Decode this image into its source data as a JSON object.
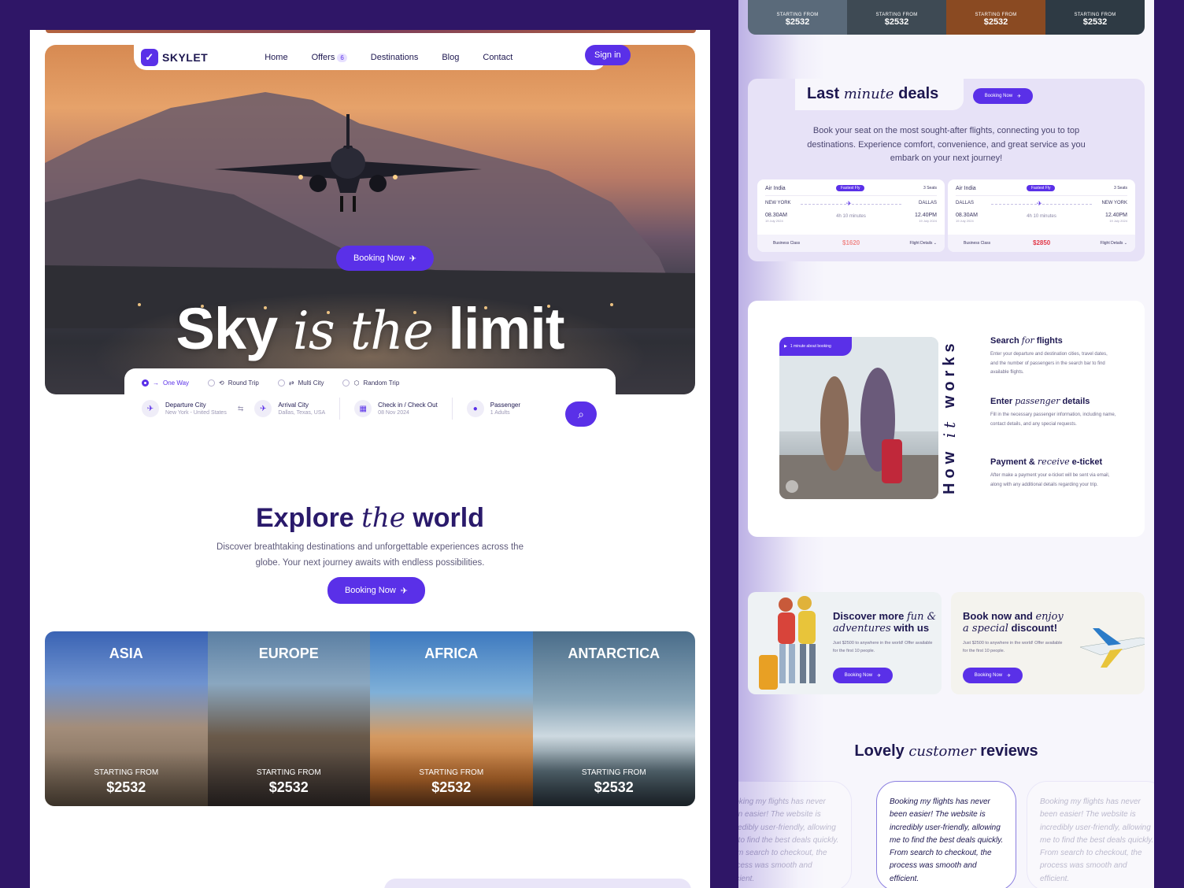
{
  "brand": {
    "name": "SKYLET",
    "accent": "#5a30e8",
    "background": "#2f1667"
  },
  "nav": {
    "links": [
      "Home",
      "Offers",
      "Destinations",
      "Blog",
      "Contact"
    ],
    "offers_badge": "6",
    "sign_in": "Sign in"
  },
  "hero": {
    "booking_label": "Booking Now",
    "title_a": "Sky",
    "title_b": "is the",
    "title_c": "limit"
  },
  "search": {
    "trip_types": [
      "One Way",
      "Round Trip",
      "Multi City",
      "Random Trip"
    ],
    "selected_trip": "One Way",
    "departure": {
      "label": "Departure City",
      "value": "New York - United States"
    },
    "arrival": {
      "label": "Arrival City",
      "value": "Dallas, Texas, USA"
    },
    "dates": {
      "label": "Check in / Check Out",
      "value": "08 Nov 2024"
    },
    "passenger": {
      "label": "Passenger",
      "value": "1 Adults"
    }
  },
  "explore": {
    "title_a": "Explore",
    "title_b": "the",
    "title_c": "world",
    "description": "Discover breathtaking destinations and unforgettable experiences across the globe. Your next journey awaits with endless possibilities.",
    "booking_label": "Booking Now",
    "destinations": [
      {
        "name": "ASIA",
        "from": "STARTING FROM",
        "price": "$2532"
      },
      {
        "name": "EUROPE",
        "from": "STARTING FROM",
        "price": "$2532"
      },
      {
        "name": "AFRICA",
        "from": "STARTING FROM",
        "price": "$2532"
      },
      {
        "name": "ANTARCTICA",
        "from": "STARTING FROM",
        "price": "$2532"
      }
    ]
  },
  "right": {
    "top_cards": [
      {
        "from": "STARTING FROM",
        "price": "$2532"
      },
      {
        "from": "STARTING FROM",
        "price": "$2532"
      },
      {
        "from": "STARTING FROM",
        "price": "$2532"
      },
      {
        "from": "STARTING FROM",
        "price": "$2532"
      }
    ],
    "last_minute": {
      "title_a": "Last",
      "title_b": "minute",
      "title_c": "deals",
      "booking_label": "Booking Now",
      "description": "Book your seat on the most sought-after flights, connecting you to top destinations. Experience comfort, convenience, and great service as you embark on your next journey!",
      "tickets": [
        {
          "airline": "Air India",
          "tag": "Fastest Fly",
          "seats": "3 Seats",
          "from_city": "NEW YORK",
          "to_city": "DALLAS",
          "dep_time": "08.30AM",
          "arr_time": "12.40PM",
          "dep_date": "19 July 2024",
          "arr_date": "19 July 2024",
          "duration": "4h 10 minutes",
          "class": "Business Class",
          "price": "$1620",
          "details": "Flight Details"
        },
        {
          "airline": "Air India",
          "tag": "Fastest Fly",
          "seats": "3 Seats",
          "from_city": "DALLAS",
          "to_city": "NEW YORK",
          "dep_time": "08.30AM",
          "arr_time": "12.40PM",
          "dep_date": "19 July 2024",
          "arr_date": "19 July 2024",
          "duration": "4h 10 minutes",
          "class": "Business Class",
          "price": "$2850",
          "details": "Flight Details"
        }
      ]
    },
    "how": {
      "badge": "1 minute about booking",
      "title_a": "How",
      "title_b": "it",
      "title_c": "works",
      "steps": [
        {
          "title_a": "Search",
          "title_b": "for",
          "title_c": "flights",
          "text": "Enter your departure and destination cities, travel dates, and the number of passengers in the search bar to find available flights."
        },
        {
          "title_a": "Enter",
          "title_b": "passenger",
          "title_c": "details",
          "text": "Fill in the necessary passenger information, including name, contact details, and any special requests."
        },
        {
          "title_a": "Payment &",
          "title_b": "receive",
          "title_c": "e-ticket",
          "text": "After make a payment your e-ticket will be sent via email, along with any additional details regarding your trip."
        }
      ]
    },
    "promos": [
      {
        "title_a": "Discover more",
        "title_b": "fun &",
        "title_c": "adventures",
        "title_d": "with us",
        "text": "Just $2500 to anywhere in the world! Offer available for the first 10 people.",
        "button": "Booking Now"
      },
      {
        "title_a": "Book now and",
        "title_b": "enjoy",
        "title_c": "a special",
        "title_d": "discount!",
        "text": "Just $2500 to anywhere in the world! Offer available for the first 10 people.",
        "button": "Booking Now"
      }
    ],
    "reviews": {
      "title_a": "Lovely",
      "title_b": "customer",
      "title_c": "reviews",
      "items": [
        "Booking my flights has never been easier! The website is incredibly user-friendly, allowing me to find the best deals quickly. From search to checkout, the process was smooth and efficient.",
        "Booking my flights has never been easier! The website is incredibly user-friendly, allowing me to find the best deals quickly. From search to checkout, the process was smooth and efficient.",
        "Booking my flights has never been easier! The website is incredibly user-friendly, allowing me to find the best deals quickly. From search to checkout, the process was smooth and efficient."
      ]
    }
  }
}
